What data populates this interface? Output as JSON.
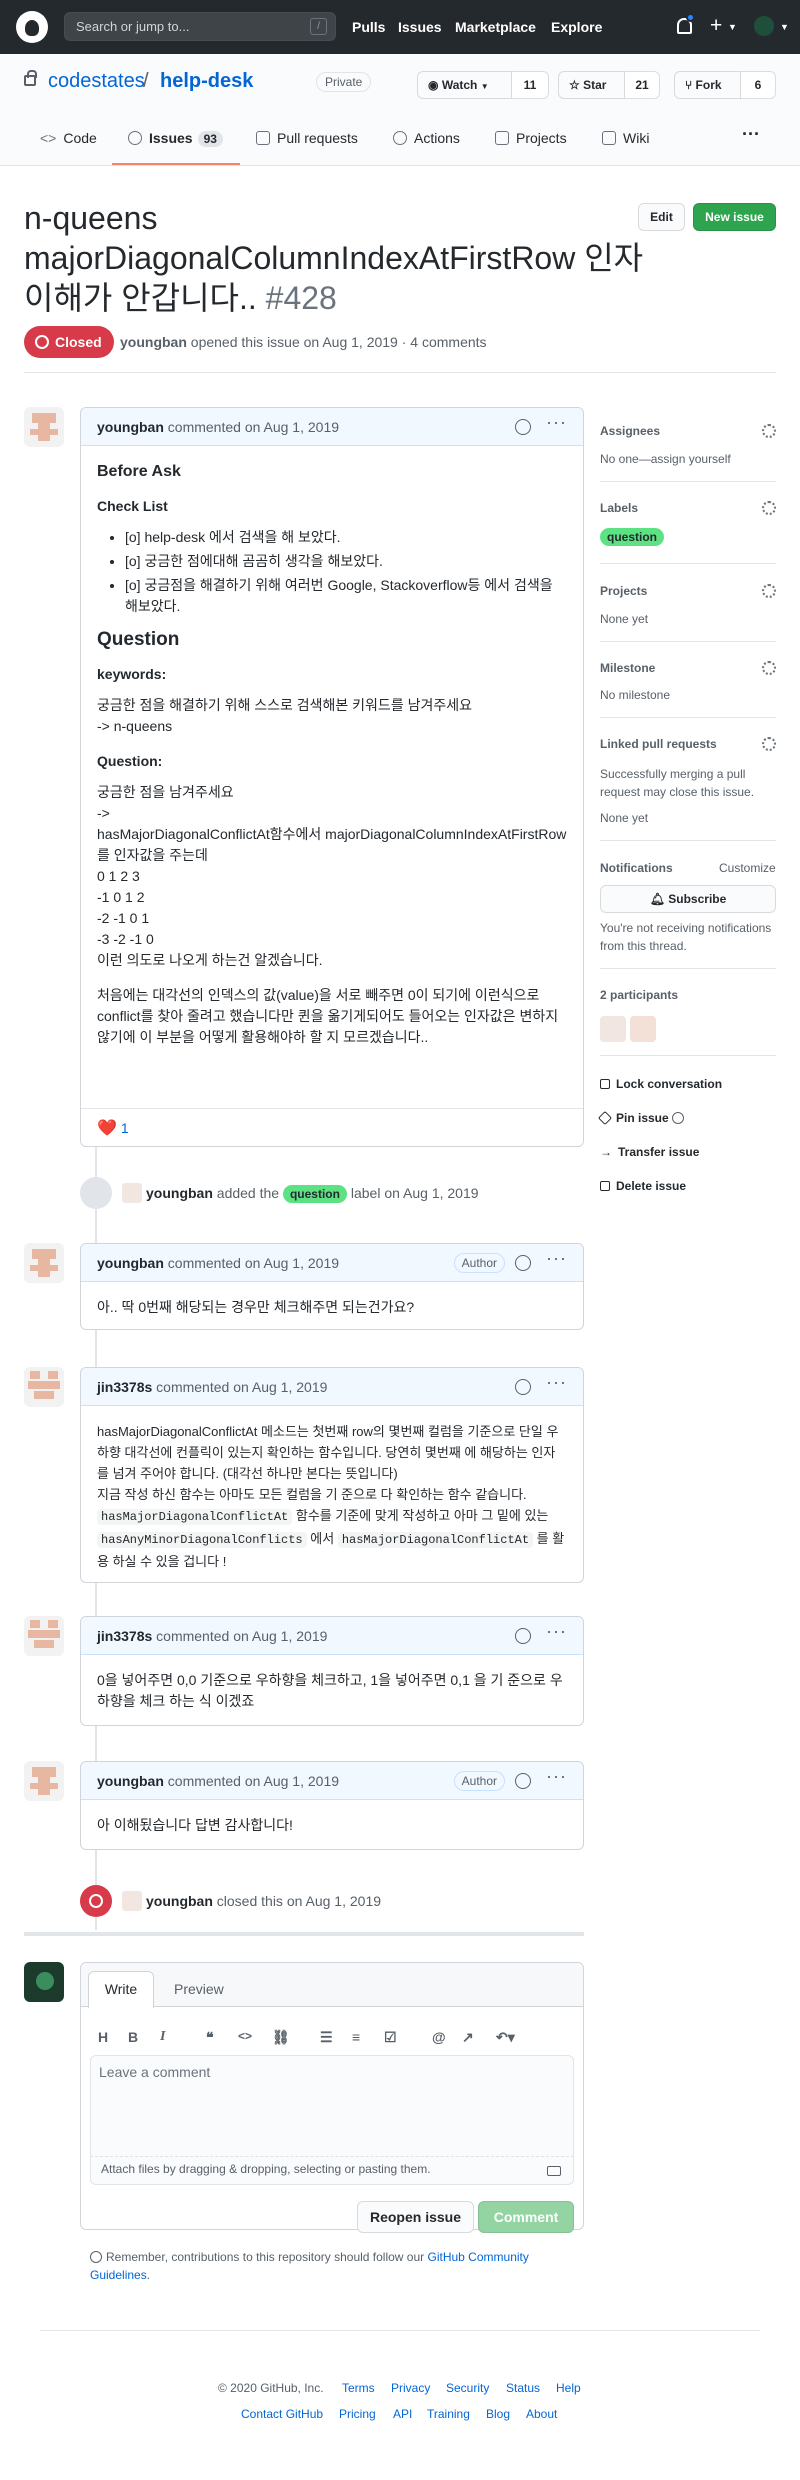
{
  "header": {
    "search_placeholder": "Search or jump to...",
    "slash_key": "/",
    "nav": [
      "Pulls",
      "Issues",
      "Marketplace",
      "Explore"
    ]
  },
  "repo": {
    "owner": "codestates",
    "separator": "/",
    "name": "help-desk",
    "visibility": "Private",
    "watch_label": "Watch",
    "watch_count": "11",
    "star_label": "Star",
    "star_count": "21",
    "fork_label": "Fork",
    "fork_count": "6",
    "tabs": [
      {
        "label": "Code"
      },
      {
        "label": "Issues",
        "count": "93"
      },
      {
        "label": "Pull requests"
      },
      {
        "label": "Actions"
      },
      {
        "label": "Projects"
      },
      {
        "label": "Wiki"
      }
    ],
    "more": "···"
  },
  "issue": {
    "title": "n-queens majorDiagonalColumnIndexAtFirstRow 인자 이해가 안갑니다..",
    "number": "#428",
    "edit_label": "Edit",
    "new_issue_label": "New issue",
    "state": "Closed",
    "author": "youngban",
    "meta": "opened this issue on Aug 1, 2019 · 4 comments"
  },
  "first_comment": {
    "author": "youngban",
    "meta": "commented on Aug 1, 2019",
    "h_before": "Before Ask",
    "h_checklist": "Check List",
    "checklist": [
      "[o] help-desk 에서 검색을 해 보았다.",
      "[o] 궁금한 점에대해 곰곰히 생각을 해보았다.",
      "[o] 궁금점을 해결하기 위해 여러번 Google, Stackoverflow등 에서 검색을 해보았다."
    ],
    "h_question": "Question",
    "h_keywords": "keywords:",
    "keywords_1": "궁금한 점을 해결하기 위해 스스로 검색해본 키워드를 남겨주세요",
    "keywords_2": "-> n-queens",
    "h_question2": "Question:",
    "q_lines": [
      "궁금한 점을 남겨주세요",
      "->",
      "hasMajorDiagonalConflictAt함수에서 majorDiagonalColumnIndexAtFirstRow를 인자값을 주는데",
      "0 1 2 3",
      "-1 0 1 2",
      "-2 -1 0 1",
      "-3 -2 -1 0",
      "이런 의도로 나오게 하는건 알겠습니다."
    ],
    "q_para": "처음에는 대각선의 인덱스의 값(value)을 서로 빼주면 0이 되기에 이런식으로 conflict를 찾아 줄려고 했습니다만 퀸을 옮기게되어도 들어오는 인자값은 변하지 않기에 이 부분을 어떻게 활용해야하 할 지 모르겠습니다..",
    "reaction_emoji": "❤️",
    "reaction_count": "1"
  },
  "label_event": {
    "actor": "youngban",
    "text_before": "added the",
    "label": "question",
    "text_after": "label on Aug 1, 2019"
  },
  "comments": [
    {
      "author": "youngban",
      "meta": "commented on Aug 1, 2019",
      "badge": "Author",
      "body": "아.. 딱 0번째 해당되는 경우만 체크해주면 되는건가요?"
    },
    {
      "author": "jin3378s",
      "meta": "commented on Aug 1, 2019",
      "body_1": "hasMajorDiagonalConflictAt 메소드는 첫번째 row의 몇번째 컬럼을 기준으로 단일 우하향 대각선에 컨플릭이 있는지 확인하는 함수입니다. 당연히 몇번째 에 해당하는 인자를 넘겨 주어야 합니다. (대각선 하나만 본다는 뜻입니다)",
      "body_2": "지금 작성 하신 함수는 아마도 모든 컬럼을 기 준으로 다 확인하는 함수 같습니다.",
      "code_1": "hasMajorDiagonalConflictAt",
      "body_3": "함수를 기준에 맞게 작성하고 아마 그 밑에 있는",
      "code_2": "hasAnyMinorDiagonalConflicts",
      "body_4": "에서",
      "code_3": "hasMajorDiagonalConflictAt",
      "body_5": "를 활용 하실 수 있을 겁니다 !"
    },
    {
      "author": "jin3378s",
      "meta": "commented on Aug 1, 2019",
      "body": "0을 넣어주면 0,0 기준으로 우하향을 체크하고, 1을 넣어주면 0,1 을 기 준으로 우하향을 체크 하는 식 이겠죠"
    },
    {
      "author": "youngban",
      "meta": "commented on Aug 1, 2019",
      "badge": "Author",
      "body": "아 이해됬습니다 답변 감사합니다!"
    }
  ],
  "close_event": {
    "actor": "youngban",
    "text": "closed this on Aug 1, 2019"
  },
  "sidebar": {
    "assignees_title": "Assignees",
    "assignees_value": "No one—assign yourself",
    "labels_title": "Labels",
    "label": "question",
    "projects_title": "Projects",
    "projects_value": "None yet",
    "milestone_title": "Milestone",
    "milestone_value": "No milestone",
    "linked_title": "Linked pull requests",
    "linked_desc": "Successfully merging a pull request may close this issue.",
    "linked_value": "None yet",
    "notifications_title": "Notifications",
    "customize": "Customize",
    "subscribe": "Subscribe",
    "notif_desc": "You're not receiving notifications from this thread.",
    "participants": "2 participants",
    "lock": "Lock conversation",
    "pin": "Pin issue",
    "transfer": "Transfer issue",
    "delete": "Delete issue"
  },
  "form": {
    "tab_write": "Write",
    "tab_preview": "Preview",
    "placeholder": "Leave a comment",
    "attach": "Attach files by dragging & dropping, selecting or pasting them.",
    "reopen": "Reopen issue",
    "comment": "Comment",
    "guidelines_prefix": "Remember, contributions to this repository should follow our",
    "guidelines_link": "GitHub Community Guidelines",
    "guidelines_suffix": "."
  },
  "footer": {
    "copyright": "© 2020 GitHub, Inc.",
    "row1": [
      "Terms",
      "Privacy",
      "Security",
      "Status",
      "Help"
    ],
    "row2": [
      "Contact GitHub",
      "Pricing",
      "API",
      "Training",
      "Blog",
      "About"
    ]
  },
  "colors": {
    "header_bg": "#24292e",
    "closed_red": "#d73a49",
    "new_issue_green": "#2ea44f",
    "label_green": "#5ce283",
    "link_blue": "#0366d6"
  }
}
